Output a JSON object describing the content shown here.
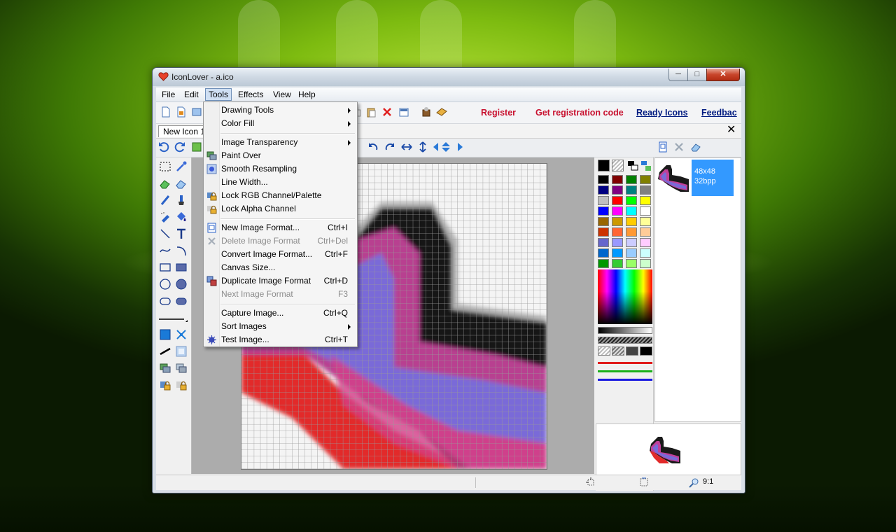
{
  "window": {
    "title": "IconLover - a.ico"
  },
  "menubar": {
    "items": [
      "File",
      "Edit",
      "Tools",
      "Effects",
      "View",
      "Help"
    ],
    "active": "Tools"
  },
  "toolbar": {
    "register": "Register",
    "get_code": "Get registration code",
    "ready_icons": "Ready Icons",
    "feedback": "Feedbac"
  },
  "doc_tab": {
    "label": "New Icon 1"
  },
  "formats": {
    "size": "48x48",
    "depth": "32bpp"
  },
  "status": {
    "zoom": "9:1"
  },
  "tools_menu": {
    "items": [
      {
        "label": "Drawing Tools",
        "submenu": true
      },
      {
        "label": "Color Fill",
        "submenu": true
      },
      {
        "label": "Image Transparency",
        "submenu": true
      },
      {
        "label": "Paint Over",
        "icon": "paint-over-icon"
      },
      {
        "label": "Smooth Resampling",
        "icon": "smooth-resampling-icon"
      },
      {
        "label": "Line Width..."
      },
      {
        "label": "Lock RGB Channel/Palette",
        "icon": "lock-icon"
      },
      {
        "label": "Lock Alpha Channel",
        "icon": "lock-icon"
      },
      {
        "label": "New Image Format...",
        "shortcut": "Ctrl+I",
        "icon": "new-format-icon"
      },
      {
        "label": "Delete Image Format",
        "shortcut": "Ctrl+Del",
        "disabled": true,
        "icon": "delete-format-icon"
      },
      {
        "label": "Convert Image Format...",
        "shortcut": "Ctrl+F"
      },
      {
        "label": "Canvas Size..."
      },
      {
        "label": "Duplicate Image Format",
        "shortcut": "Ctrl+D",
        "icon": "duplicate-icon"
      },
      {
        "label": "Next Image Format",
        "shortcut": "F3",
        "disabled": true
      },
      {
        "label": "Capture Image...",
        "shortcut": "Ctrl+Q"
      },
      {
        "label": "Sort Images",
        "submenu": true
      },
      {
        "label": "Test Image...",
        "shortcut": "Ctrl+T",
        "icon": "test-icon"
      }
    ]
  },
  "palette_colors": [
    "#000000",
    "#800000",
    "#008000",
    "#808000",
    "#000080",
    "#800080",
    "#008080",
    "#808080",
    "#c0c0c0",
    "#ff0000",
    "#00ff00",
    "#ffff00",
    "#0000ff",
    "#ff00ff",
    "#00ffff",
    "#ffffff",
    "#996600",
    "#cc9900",
    "#ffcc00",
    "#ffff99",
    "#cc3300",
    "#ff6633",
    "#ff9933",
    "#ffcc99",
    "#6666cc",
    "#9999ff",
    "#ccccff",
    "#ffccff",
    "#0066cc",
    "#0099ff",
    "#99ccff",
    "#ccffff",
    "#009900",
    "#33cc33",
    "#99ff66",
    "#ccffcc"
  ],
  "colors": {
    "accent": "#3399ff",
    "link_red": "#c8102e",
    "link_blue": "#001a80"
  }
}
